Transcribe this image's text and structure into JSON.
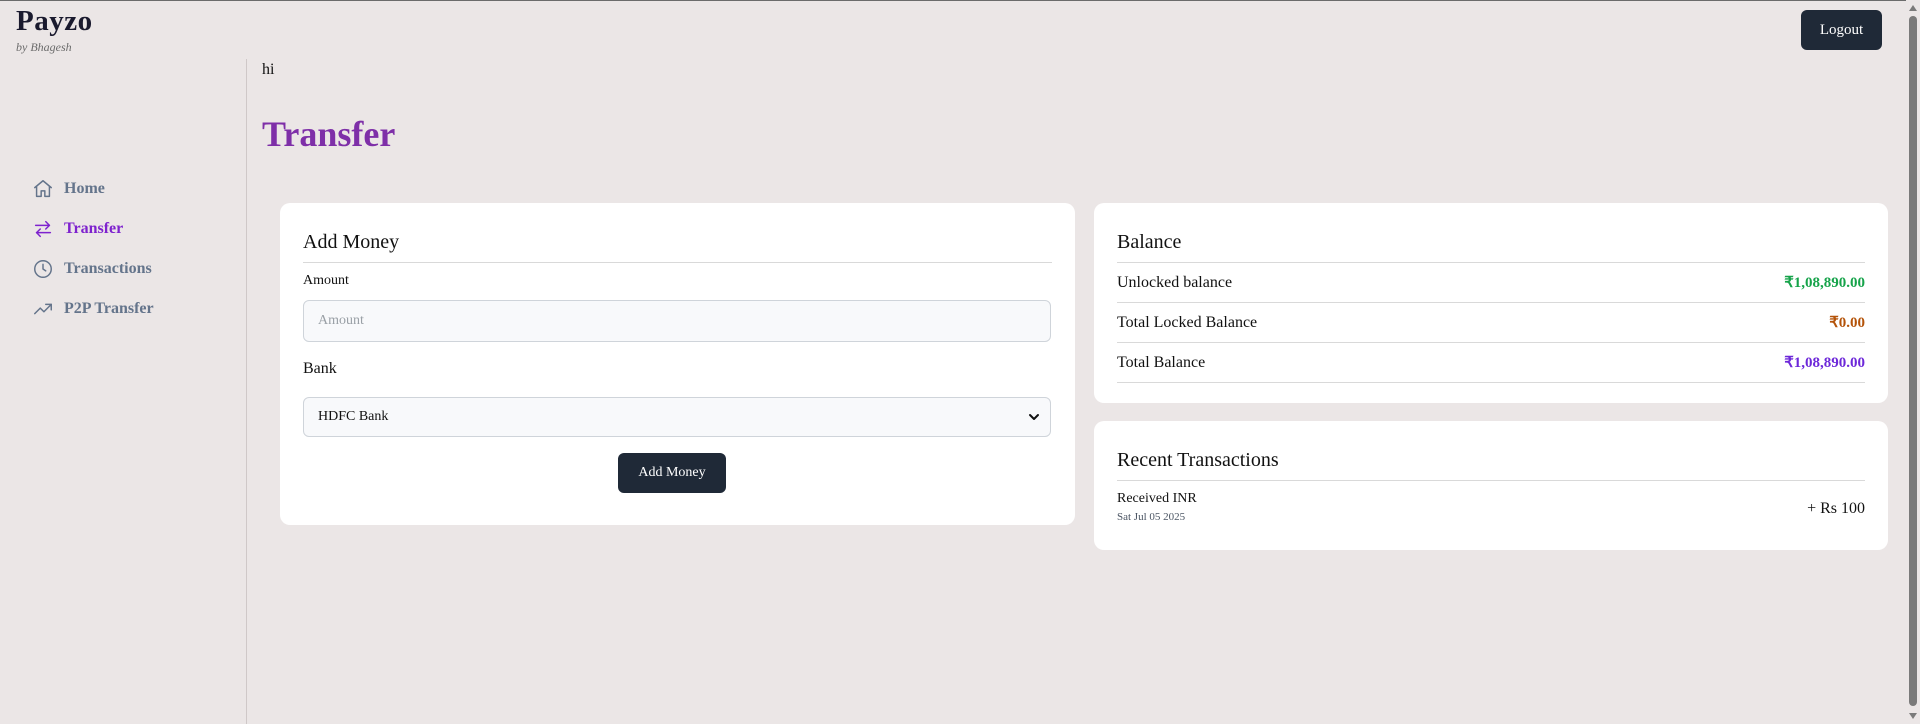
{
  "brand": {
    "name": "Payzo",
    "byline": "by Bhagesh"
  },
  "header": {
    "logout_label": "Logout"
  },
  "sidebar": {
    "items": [
      {
        "label": "Home",
        "icon": "home-icon",
        "active": false
      },
      {
        "label": "Transfer",
        "icon": "transfer-arrows-icon",
        "active": true
      },
      {
        "label": "Transactions",
        "icon": "clock-icon",
        "active": false
      },
      {
        "label": "P2P Transfer",
        "icon": "trending-up-icon",
        "active": false
      }
    ]
  },
  "main": {
    "greeting": "hi",
    "title": "Transfer"
  },
  "add_money": {
    "title": "Add Money",
    "amount_label": "Amount",
    "amount_placeholder": "Amount",
    "amount_value": "",
    "bank_label": "Bank",
    "bank_selected": "HDFC Bank",
    "button_label": "Add Money"
  },
  "balance": {
    "title": "Balance",
    "rows": [
      {
        "label": "Unlocked balance",
        "value": "₹1,08,890.00",
        "color": "#16a34a"
      },
      {
        "label": "Total Locked Balance",
        "value": "₹0.00",
        "color": "#b45309"
      },
      {
        "label": "Total Balance",
        "value": "₹1,08,890.00",
        "color": "#6d28d9"
      }
    ]
  },
  "recent_transactions": {
    "title": "Recent Transactions",
    "items": [
      {
        "title": "Received INR",
        "date": "Sat Jul 05 2025",
        "amount": "+ Rs 100"
      }
    ]
  },
  "colors": {
    "background": "#ebe6e6",
    "accent_purple": "#7e22ce",
    "dark_button": "#1f2937",
    "nav_muted": "#64748b"
  }
}
